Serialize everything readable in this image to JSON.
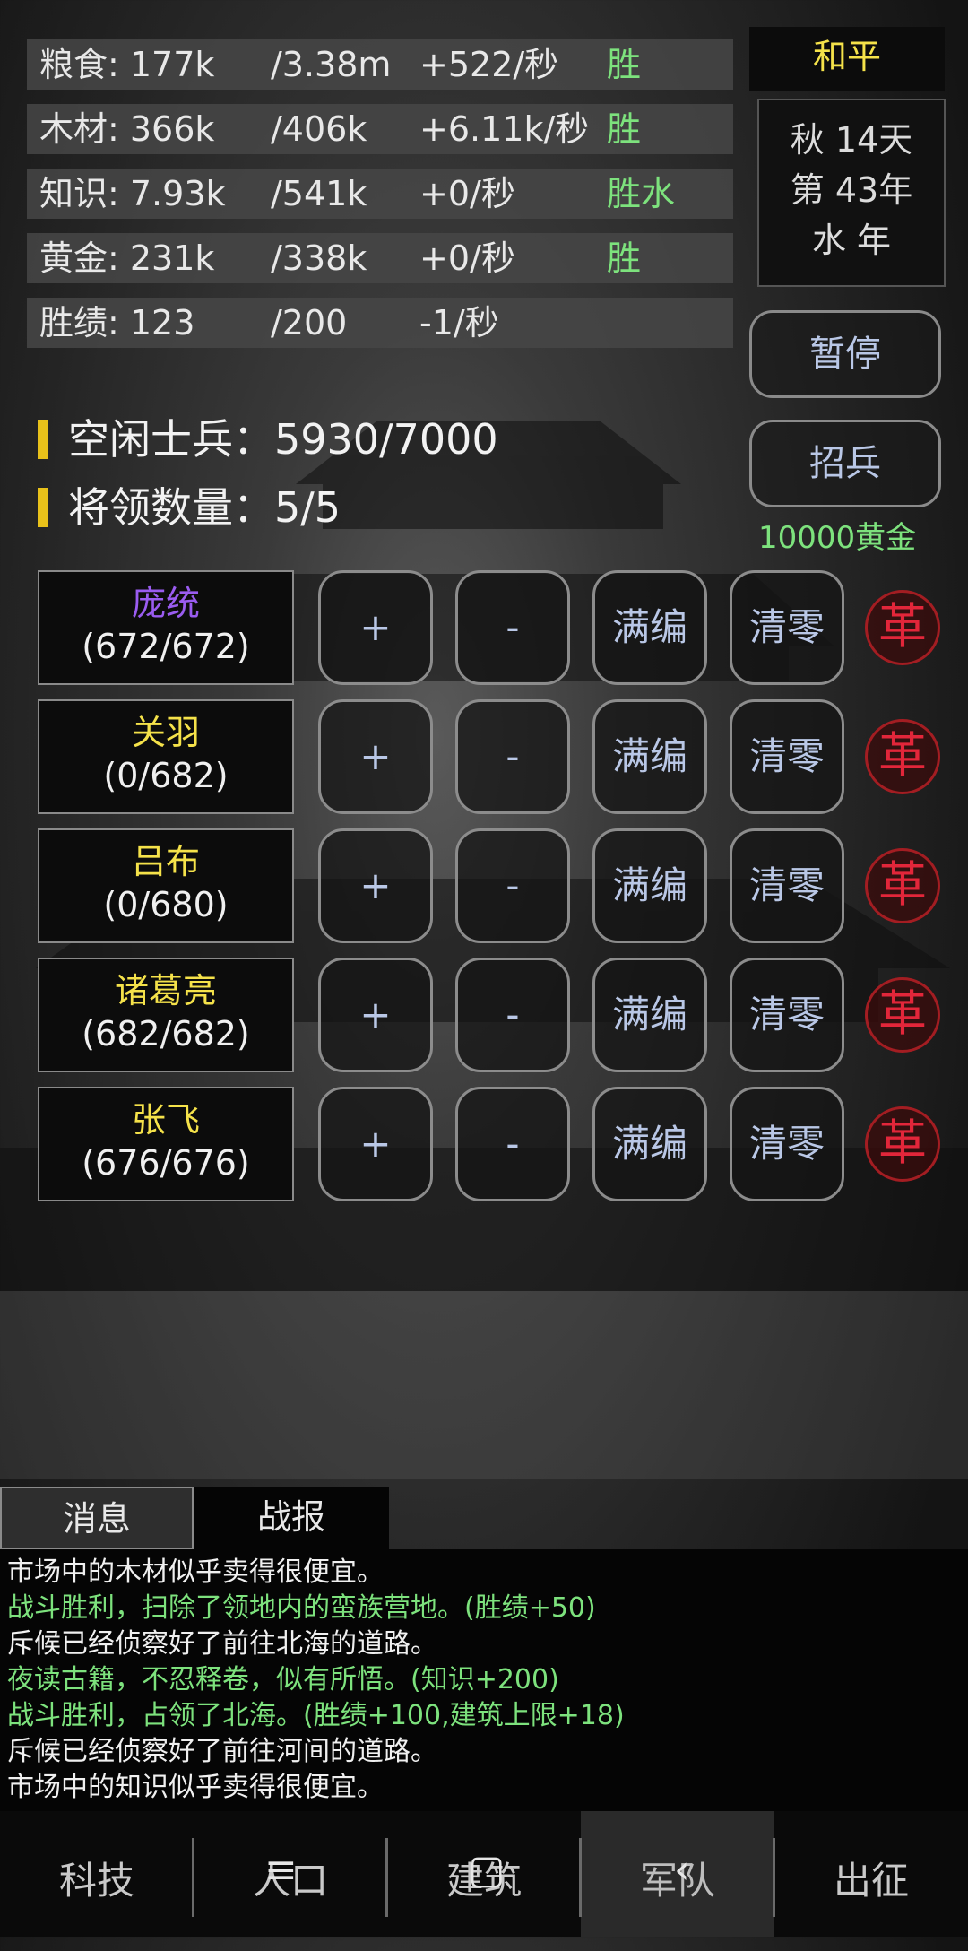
{
  "resources": [
    {
      "name": "粮食: 177k",
      "max": "/3.38m",
      "rate": "+522/秒",
      "tag": "胜"
    },
    {
      "name": "木材: 366k",
      "max": "/406k",
      "rate": "+6.11k/秒",
      "tag": "胜"
    },
    {
      "name": "知识: 7.93k",
      "max": "/541k",
      "rate": "+0/秒",
      "tag": "胜水"
    },
    {
      "name": "黄金: 231k",
      "max": "/338k",
      "rate": "+0/秒",
      "tag": "胜"
    },
    {
      "name": "胜绩: 123",
      "max": "/200",
      "rate": "-1/秒",
      "tag": ""
    }
  ],
  "status": {
    "state": "和平",
    "date_line1": "秋 14天",
    "date_line2": "第 43年",
    "date_line3": "水 年"
  },
  "buttons": {
    "pause": "暂停",
    "recruit": "招兵",
    "recruit_cost": "10000黄金"
  },
  "army": {
    "idle_soldiers": "空闲士兵：5930/7000",
    "general_count": "将领数量：5/5"
  },
  "generals": [
    {
      "name": "庞统",
      "count": "(672/672)",
      "color": "#9a5cf0"
    },
    {
      "name": "关羽",
      "count": "(0/682)",
      "color": "#f5e24a"
    },
    {
      "name": "吕布",
      "count": "(0/680)",
      "color": "#f5e24a"
    },
    {
      "name": "诸葛亮",
      "count": "(682/682)",
      "color": "#f5e24a"
    },
    {
      "name": "张飞",
      "count": "(676/676)",
      "color": "#f5e24a"
    }
  ],
  "controls": {
    "plus": "+",
    "minus": "-",
    "fill": "满编",
    "clear": "清零",
    "revolt": "革"
  },
  "tabs": {
    "messages": "消息",
    "battle": "战报"
  },
  "log": [
    {
      "text": "市场中的木材似乎卖得很便宜。",
      "color": "#f0f0f0"
    },
    {
      "text": "战斗胜利，扫除了领地内的蛮族营地。(胜绩+50)",
      "color": "#7de27d"
    },
    {
      "text": "斥候已经侦察好了前往北海的道路。",
      "color": "#f0f0f0"
    },
    {
      "text": "夜读古籍，不忍释卷，似有所悟。(知识+200)",
      "color": "#7de27d"
    },
    {
      "text": "战斗胜利，占领了北海。(胜绩+100,建筑上限+18)",
      "color": "#7de27d"
    },
    {
      "text": "斥候已经侦察好了前往河间的道路。",
      "color": "#f0f0f0"
    },
    {
      "text": "市场中的知识似乎卖得很便宜。",
      "color": "#f0f0f0"
    }
  ],
  "nav": [
    "科技",
    "人口",
    "建筑",
    "军队",
    "出征"
  ],
  "nav_active": "军队",
  "system_nav": {
    "menu": "menu-icon",
    "home": "home-icon",
    "back": "back-icon"
  }
}
